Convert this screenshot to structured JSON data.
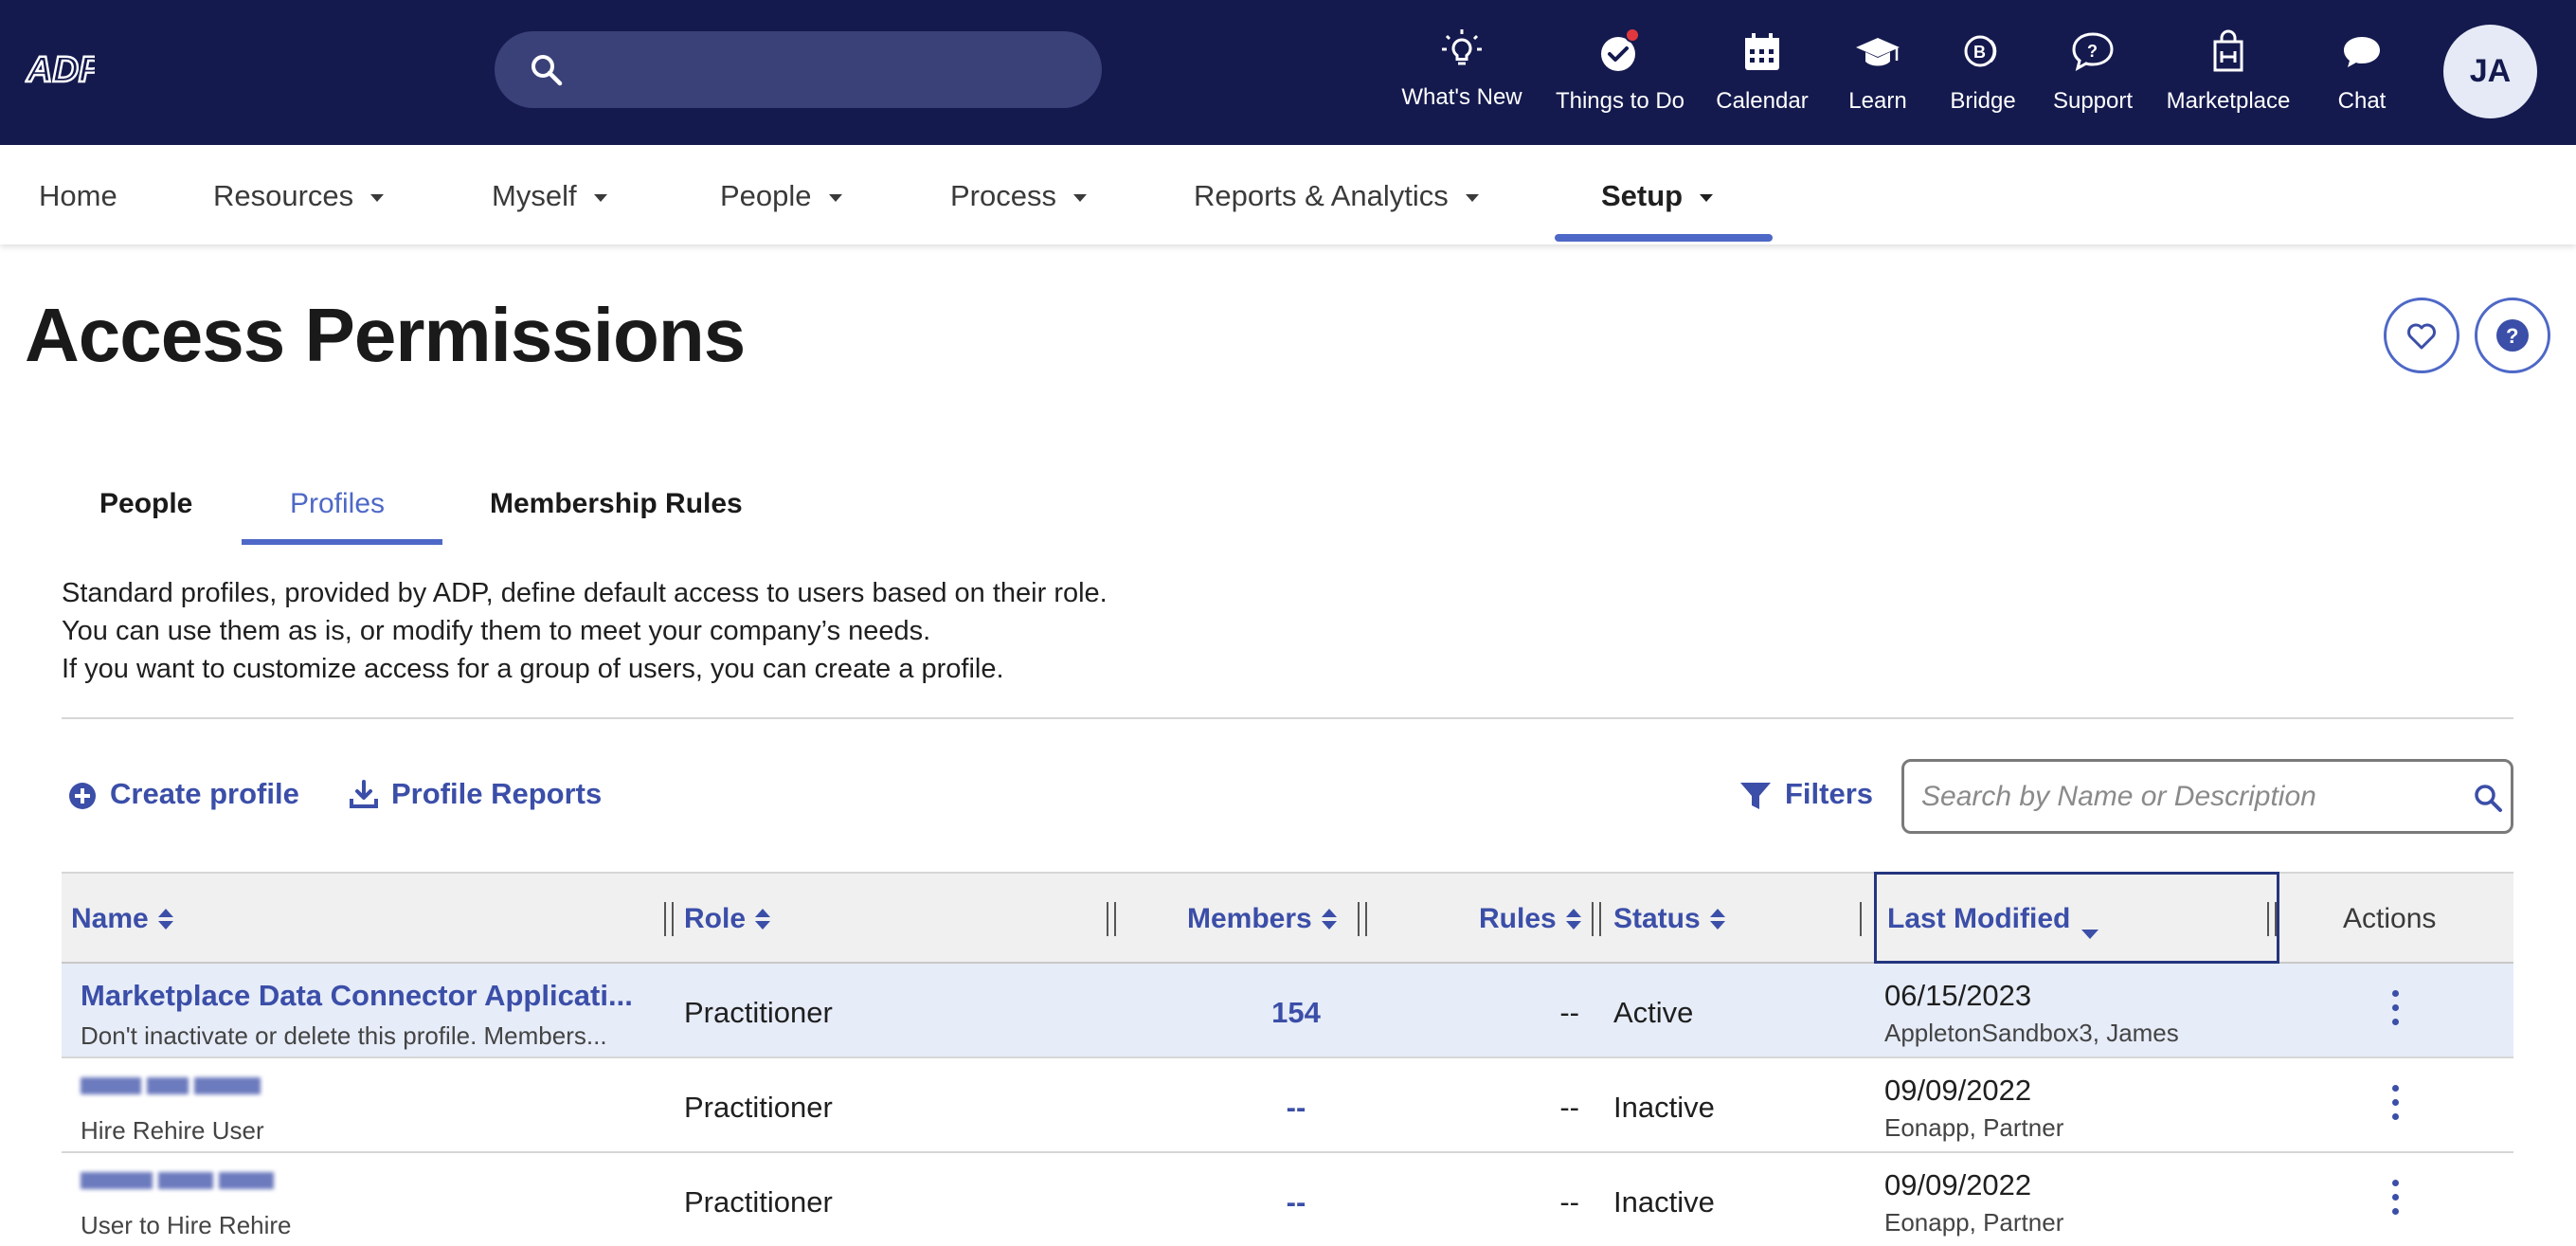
{
  "topbar": {
    "logo_text": "ADP",
    "search": {
      "placeholder": ""
    },
    "items": [
      {
        "label": "What's New",
        "icon": "lightbulb-icon"
      },
      {
        "label": "Things to Do",
        "icon": "checkmark-circle-icon"
      },
      {
        "label": "Calendar",
        "icon": "calendar-icon"
      },
      {
        "label": "Learn",
        "icon": "graduation-cap-icon"
      },
      {
        "label": "Bridge",
        "icon": "bridge-icon"
      },
      {
        "label": "Support",
        "icon": "question-bubble-icon"
      },
      {
        "label": "Marketplace",
        "icon": "shopping-bag-icon"
      },
      {
        "label": "Chat",
        "icon": "chat-bubble-icon"
      }
    ],
    "avatar_initials": "JA"
  },
  "subnav": {
    "items": [
      {
        "label": "Home",
        "dropdown": false
      },
      {
        "label": "Resources",
        "dropdown": true
      },
      {
        "label": "Myself",
        "dropdown": true
      },
      {
        "label": "People",
        "dropdown": true
      },
      {
        "label": "Process",
        "dropdown": true
      },
      {
        "label": "Reports & Analytics",
        "dropdown": true
      },
      {
        "label": "Setup",
        "dropdown": true,
        "active": true
      }
    ]
  },
  "page": {
    "title": "Access Permissions",
    "tabs": [
      {
        "label": "People"
      },
      {
        "label": "Profiles",
        "active": true
      },
      {
        "label": "Membership Rules"
      }
    ],
    "description": [
      "Standard profiles, provided by ADP, define default access to users based on their role.",
      "You can use them as is, or modify them to meet your company’s needs.",
      "If you want to customize access for a group of users, you can create a profile."
    ]
  },
  "toolbar": {
    "create_label": "Create profile",
    "reports_label": "Profile Reports",
    "filters_label": "Filters",
    "search_placeholder": "Search by Name or Description"
  },
  "table": {
    "columns": [
      "Name",
      "Role",
      "Members",
      "Rules",
      "Status",
      "Last Modified",
      "Actions"
    ],
    "sorted_column": "Last Modified",
    "rows": [
      {
        "name": "Marketplace Data Connector Applicati...",
        "description": "Don't inactivate or delete this profile. Members...",
        "role": "Practitioner",
        "members": "154",
        "rules": "--",
        "status": "Active",
        "date": "06/15/2023",
        "modified_by": "AppletonSandbox3, James",
        "selected": true,
        "name_obscured": false
      },
      {
        "name": "",
        "description": "Hire Rehire User",
        "role": "Practitioner",
        "members": "--",
        "rules": "--",
        "status": "Inactive",
        "date": "09/09/2022",
        "modified_by": "Eonapp, Partner",
        "selected": false,
        "name_obscured": true
      },
      {
        "name": "",
        "description": "User to Hire Rehire",
        "role": "Practitioner",
        "members": "--",
        "rules": "--",
        "status": "Inactive",
        "date": "09/09/2022",
        "modified_by": "Eonapp, Partner",
        "selected": false,
        "name_obscured": true
      }
    ]
  },
  "colors": {
    "topbar_bg": "#141a4e",
    "accent": "#4e68c7",
    "link": "#3b4ea8",
    "selected_row": "#e6ecf8",
    "notification_dot": "#e0383e"
  }
}
